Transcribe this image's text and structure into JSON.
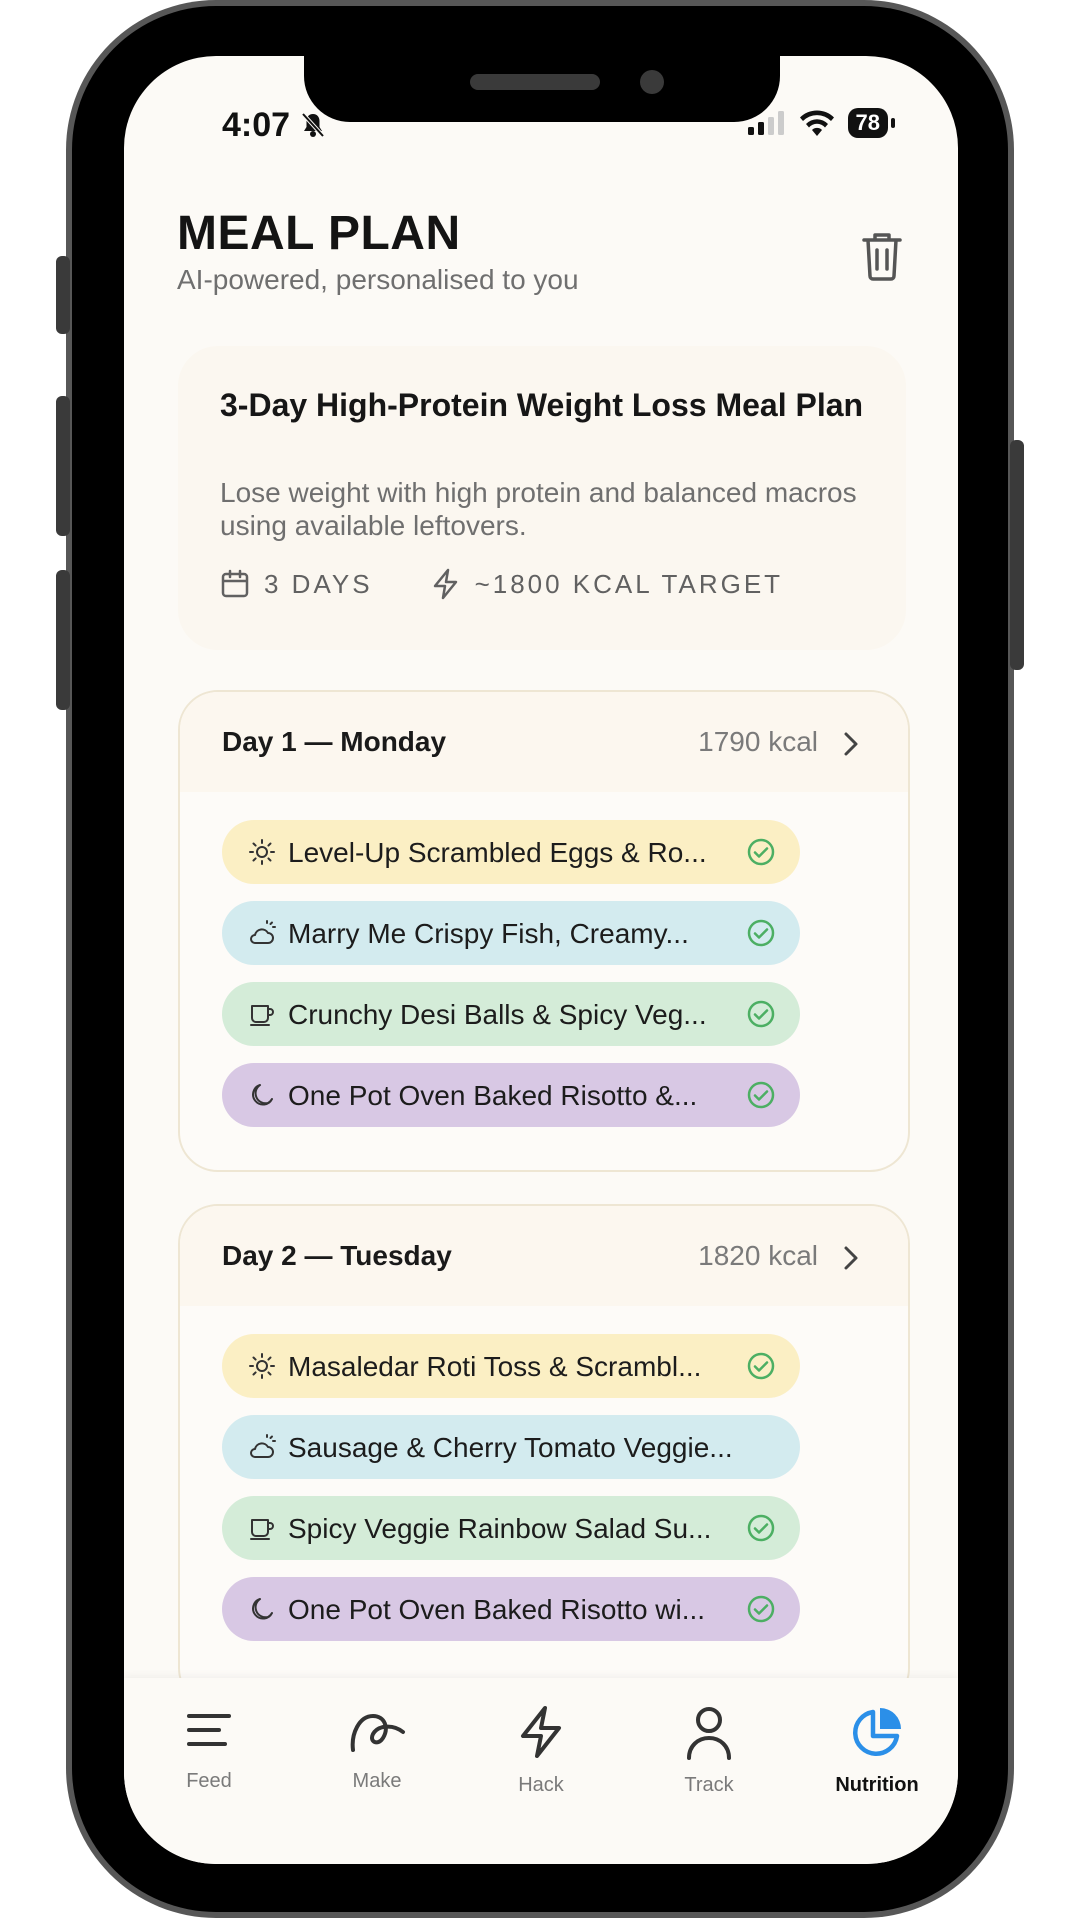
{
  "status_bar": {
    "time": "4:07",
    "battery": "78"
  },
  "header": {
    "title": "MEAL PLAN",
    "subtitle": "AI-powered, personalised to you"
  },
  "plan": {
    "title": "3-Day High-Protein Weight Loss Meal Plan",
    "description": "Lose weight with high protein and balanced macros using available leftovers.",
    "days_label": "3 DAYS",
    "kcal_label": "~1800 KCAL TARGET"
  },
  "days": [
    {
      "title": "Day 1 — Monday",
      "kcal": "1790 kcal",
      "meals": [
        {
          "label": "Level-Up Scrambled Eggs & Ro...",
          "icon": "sun-icon",
          "color": "#fbefc4",
          "checked": true
        },
        {
          "label": "Marry Me Crispy Fish, Creamy...",
          "icon": "cloud-sun-icon",
          "color": "#d3ebef",
          "checked": true
        },
        {
          "label": "Crunchy Desi Balls & Spicy Veg...",
          "icon": "cup-icon",
          "color": "#d4ecd8",
          "checked": true
        },
        {
          "label": "One Pot Oven Baked Risotto &...",
          "icon": "moon-icon",
          "color": "#d8c8e4",
          "checked": true
        }
      ]
    },
    {
      "title": "Day 2 — Tuesday",
      "kcal": "1820 kcal",
      "meals": [
        {
          "label": "Masaledar Roti Toss & Scrambl...",
          "icon": "sun-icon",
          "color": "#fbefc4",
          "checked": true
        },
        {
          "label": "Sausage & Cherry Tomato Veggie...",
          "icon": "cloud-sun-icon",
          "color": "#d3ebef",
          "checked": false
        },
        {
          "label": "Spicy Veggie Rainbow Salad Su...",
          "icon": "cup-icon",
          "color": "#d4ecd8",
          "checked": true
        },
        {
          "label": "One Pot Oven Baked Risotto wi...",
          "icon": "moon-icon",
          "color": "#d8c8e4",
          "checked": true
        }
      ]
    }
  ],
  "nav": [
    {
      "label": "Feed",
      "icon": "feed-icon",
      "active": false
    },
    {
      "label": "Make",
      "icon": "make-icon",
      "active": false
    },
    {
      "label": "Hack",
      "icon": "bolt-icon",
      "active": false
    },
    {
      "label": "Track",
      "icon": "person-icon",
      "active": false
    },
    {
      "label": "Nutrition",
      "icon": "pie-chart-icon",
      "active": true
    }
  ],
  "colors": {
    "accent": "#2b8fe8",
    "check": "#4caf63",
    "background": "#fcfaf6"
  }
}
